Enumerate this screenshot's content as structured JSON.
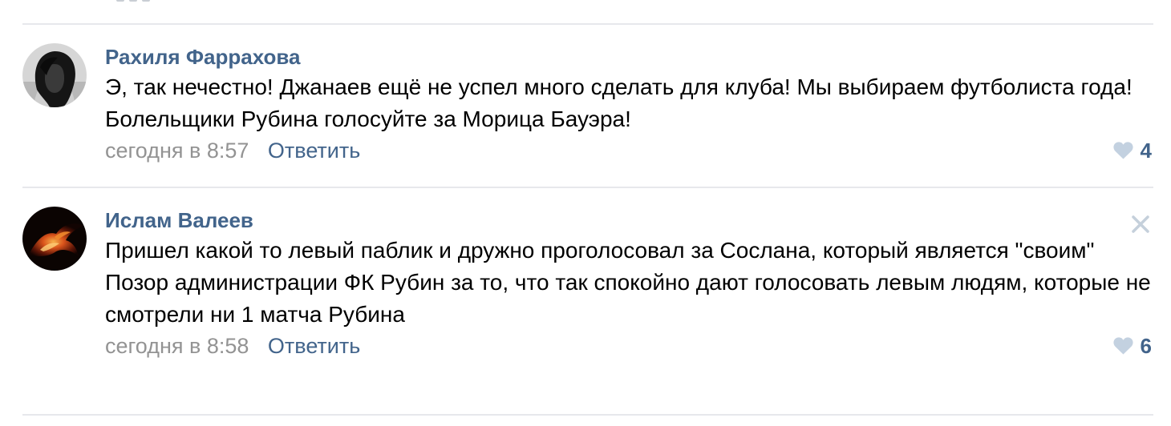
{
  "colors": {
    "link": "#42648b",
    "meta": "#939393",
    "divider": "#e7e8ec",
    "like_icon": "#c3d1e0",
    "close_icon": "#c5d0db"
  },
  "comments": [
    {
      "author": "Рахиля Фаррахова",
      "avatar": "avatar-photo",
      "text": [
        "Э, так нечестно! Джанаев ещё не успел много сделать для клуба! Мы выбираем футболиста года! Болельщики Рубина голосуйте за Морица Бауэра!"
      ],
      "date": "сегодня в 8:57",
      "reply_label": "Ответить",
      "likes": "4",
      "like_icon": "heart-icon"
    },
    {
      "author": "Ислам Валеев",
      "avatar": "avatar-photo",
      "text": [
        "Пришел какой то левый паблик и дружно проголосовал за Сослана, который является \"своим\"",
        "Позор администрации ФК Рубин за то, что так спокойно дают голосовать левым людям, которые не смотрели ни 1 матча Рубина"
      ],
      "date": "сегодня в 8:58",
      "reply_label": "Ответить",
      "likes": "6",
      "like_icon": "heart-icon",
      "close_icon": "close-icon"
    }
  ]
}
